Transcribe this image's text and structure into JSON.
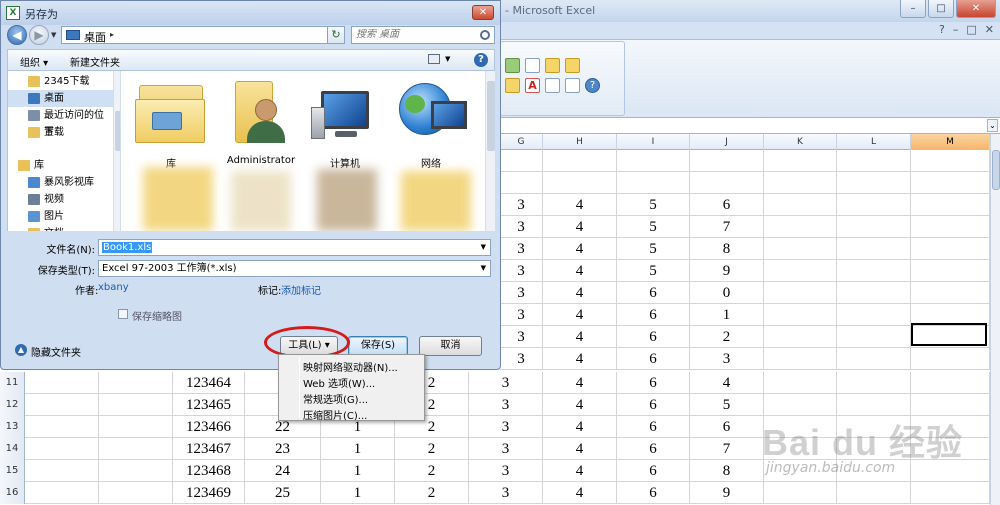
{
  "excel": {
    "title": "Microsoft Excel",
    "title_prefix": "- ",
    "win_controls": [
      "–",
      "□",
      "✕"
    ],
    "inner_controls": [
      "?",
      "–",
      "□",
      "✕"
    ],
    "columns": [
      "G",
      "H",
      "I",
      "J",
      "K",
      "L",
      "M"
    ],
    "selected_column": "M",
    "rows": [
      {
        "num": "",
        "cells": [
          "",
          "",
          "",
          ""
        ]
      },
      {
        "num": "",
        "cells": [
          "",
          "",
          "",
          ""
        ]
      },
      {
        "num": "",
        "cells": [
          "3",
          "4",
          "5",
          "6"
        ]
      },
      {
        "num": "",
        "cells": [
          "3",
          "4",
          "5",
          "7"
        ]
      },
      {
        "num": "",
        "cells": [
          "3",
          "4",
          "5",
          "8"
        ]
      },
      {
        "num": "",
        "cells": [
          "3",
          "4",
          "5",
          "9"
        ]
      },
      {
        "num": "",
        "cells": [
          "3",
          "4",
          "6",
          "0"
        ]
      },
      {
        "num": "",
        "cells": [
          "3",
          "4",
          "6",
          "1"
        ]
      },
      {
        "num": "",
        "cells": [
          "3",
          "4",
          "6",
          "2"
        ]
      },
      {
        "num": "",
        "cells": [
          "3",
          "4",
          "6",
          "3"
        ]
      }
    ],
    "visible_rows": [
      {
        "num": "11",
        "a": "123464",
        "b": "",
        "c": "",
        "d": "2",
        "e": "3",
        "f": "4",
        "g": "6",
        "h": "4"
      },
      {
        "num": "12",
        "a": "123465",
        "b": "",
        "c": "",
        "d": "2",
        "e": "3",
        "f": "4",
        "g": "6",
        "h": "5"
      },
      {
        "num": "13",
        "a": "123466",
        "b": "22",
        "c": "1",
        "d": "2",
        "e": "3",
        "f": "4",
        "g": "6",
        "h": "6"
      },
      {
        "num": "14",
        "a": "123467",
        "b": "23",
        "c": "1",
        "d": "2",
        "e": "3",
        "f": "4",
        "g": "6",
        "h": "7"
      },
      {
        "num": "15",
        "a": "123468",
        "b": "24",
        "c": "1",
        "d": "2",
        "e": "3",
        "f": "4",
        "g": "6",
        "h": "8"
      },
      {
        "num": "16",
        "a": "123469",
        "b": "25",
        "c": "1",
        "d": "2",
        "e": "3",
        "f": "4",
        "g": "6",
        "h": "9"
      }
    ]
  },
  "dialog": {
    "title": "另存为",
    "close": "✕",
    "nav": {
      "back": "◀",
      "forward": "▶",
      "path_label": "桌面",
      "path_arrow": "▸",
      "refresh": "↻",
      "search_placeholder": "搜索 桌面"
    },
    "toolbar": {
      "organize": "组织 ▾",
      "new_folder": "新建文件夹",
      "help": "?"
    },
    "sidebar": [
      {
        "label": "2345下载",
        "icon": "download-folder-icon",
        "color": "#e8c15a"
      },
      {
        "label": "桌面",
        "icon": "desktop-icon",
        "color": "#3d78bf",
        "selected": true
      },
      {
        "label": "最近访问的位置",
        "icon": "recent-places-icon",
        "color": "#7d8fa6"
      },
      {
        "label": "下载",
        "icon": "downloads-icon",
        "color": "#e8c15a"
      },
      {
        "label": "库",
        "icon": "libraries-icon",
        "color": "#e8c15a"
      },
      {
        "label": "暴风影视库",
        "icon": "video-library-icon",
        "color": "#4a88d0"
      },
      {
        "label": "视频",
        "icon": "video-icon",
        "color": "#6b7f99"
      },
      {
        "label": "图片",
        "icon": "pictures-icon",
        "color": "#5b95cf"
      },
      {
        "label": "文档",
        "icon": "documents-icon",
        "color": "#e8c15a"
      }
    ],
    "files": [
      {
        "label": "库",
        "icon": "library-folder-icon"
      },
      {
        "label": "Administrator",
        "icon": "user-folder-icon"
      },
      {
        "label": "计算机",
        "icon": "computer-icon"
      },
      {
        "label": "网络",
        "icon": "network-globe-icon"
      }
    ],
    "form": {
      "filename_label": "文件名(N):",
      "filename_value": "Book1.xls",
      "filetype_label": "保存类型(T):",
      "filetype_value": "Excel 97-2003 工作簿(*.xls)",
      "author_label": "作者:",
      "author_value": "xbany",
      "tags_label": "标记:",
      "tags_value": "添加标记",
      "thumbnail_label": "保存缩略图"
    },
    "bottom": {
      "hide_folders": "隐藏文件夹",
      "tools": "工具(L)",
      "tools_arrow": "▾",
      "save": "保存(S)",
      "cancel": "取消"
    },
    "tools_menu": [
      "映射网络驱动器(N)...",
      "Web 选项(W)...",
      "常规选项(G)...",
      "压缩图片(C)..."
    ]
  },
  "watermark": {
    "logo": "Bai du 经验",
    "url": "jingyan.baidu.com"
  },
  "colors": {
    "accent": "#3399ff",
    "highlight_circle": "#d51a1a",
    "selected_column": "#f6b56a"
  }
}
